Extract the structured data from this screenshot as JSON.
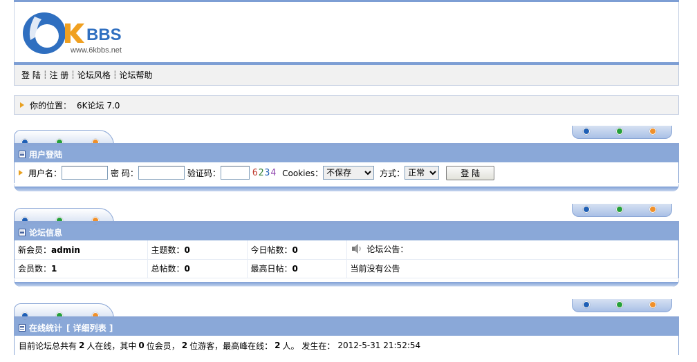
{
  "logo": {
    "text": "BBS",
    "mark": "6K",
    "url_text": "www.6kbbs.net"
  },
  "menu": [
    {
      "label": "登 陆"
    },
    {
      "label": "注 册"
    },
    {
      "label": "论坛风格"
    },
    {
      "label": "论坛帮助"
    }
  ],
  "breadcrumb": {
    "label": "你的位置：",
    "link": "6K论坛 7.0"
  },
  "login": {
    "title": "用户登陆",
    "username_label": "用户名：",
    "password_label": "密 码：",
    "captcha_label": "验证码：",
    "captcha_value": "6234",
    "cookies_label": "Cookies：",
    "cookies_selected": "不保存",
    "mode_label": "方式：",
    "mode_selected": "正常",
    "submit_label": "登 陆"
  },
  "forum_info": {
    "title": "论坛信息",
    "newest_member_label": "新会员：",
    "newest_member": "admin",
    "topics_label": "主题数：",
    "topics": "0",
    "today_posts_label": "今日帖数：",
    "today_posts": "0",
    "notice_label": "论坛公告：",
    "members_label": "会员数：",
    "members": "1",
    "total_posts_label": "总帖数：",
    "total_posts": "0",
    "max_day_label": "最高日帖：",
    "max_day": "0",
    "notice_text": "当前没有公告"
  },
  "online": {
    "title": "在线统计",
    "detail_link": "[ 详细列表 ]",
    "text_prefix": "目前论坛总共有",
    "total": "2",
    "text_a": "人在线，其中",
    "members": "0",
    "text_b": "位会员，",
    "guests": "2",
    "text_c": "位游客，最高峰在线：",
    "peak": "2",
    "text_d": "人。 发生在：",
    "peak_time": "2012-5-31 21:52:54"
  },
  "colors": {
    "accent": "#8aa8d8",
    "dot_blue": "#1f5fb5",
    "dot_green": "#26a03a",
    "dot_orange": "#f0902a"
  }
}
